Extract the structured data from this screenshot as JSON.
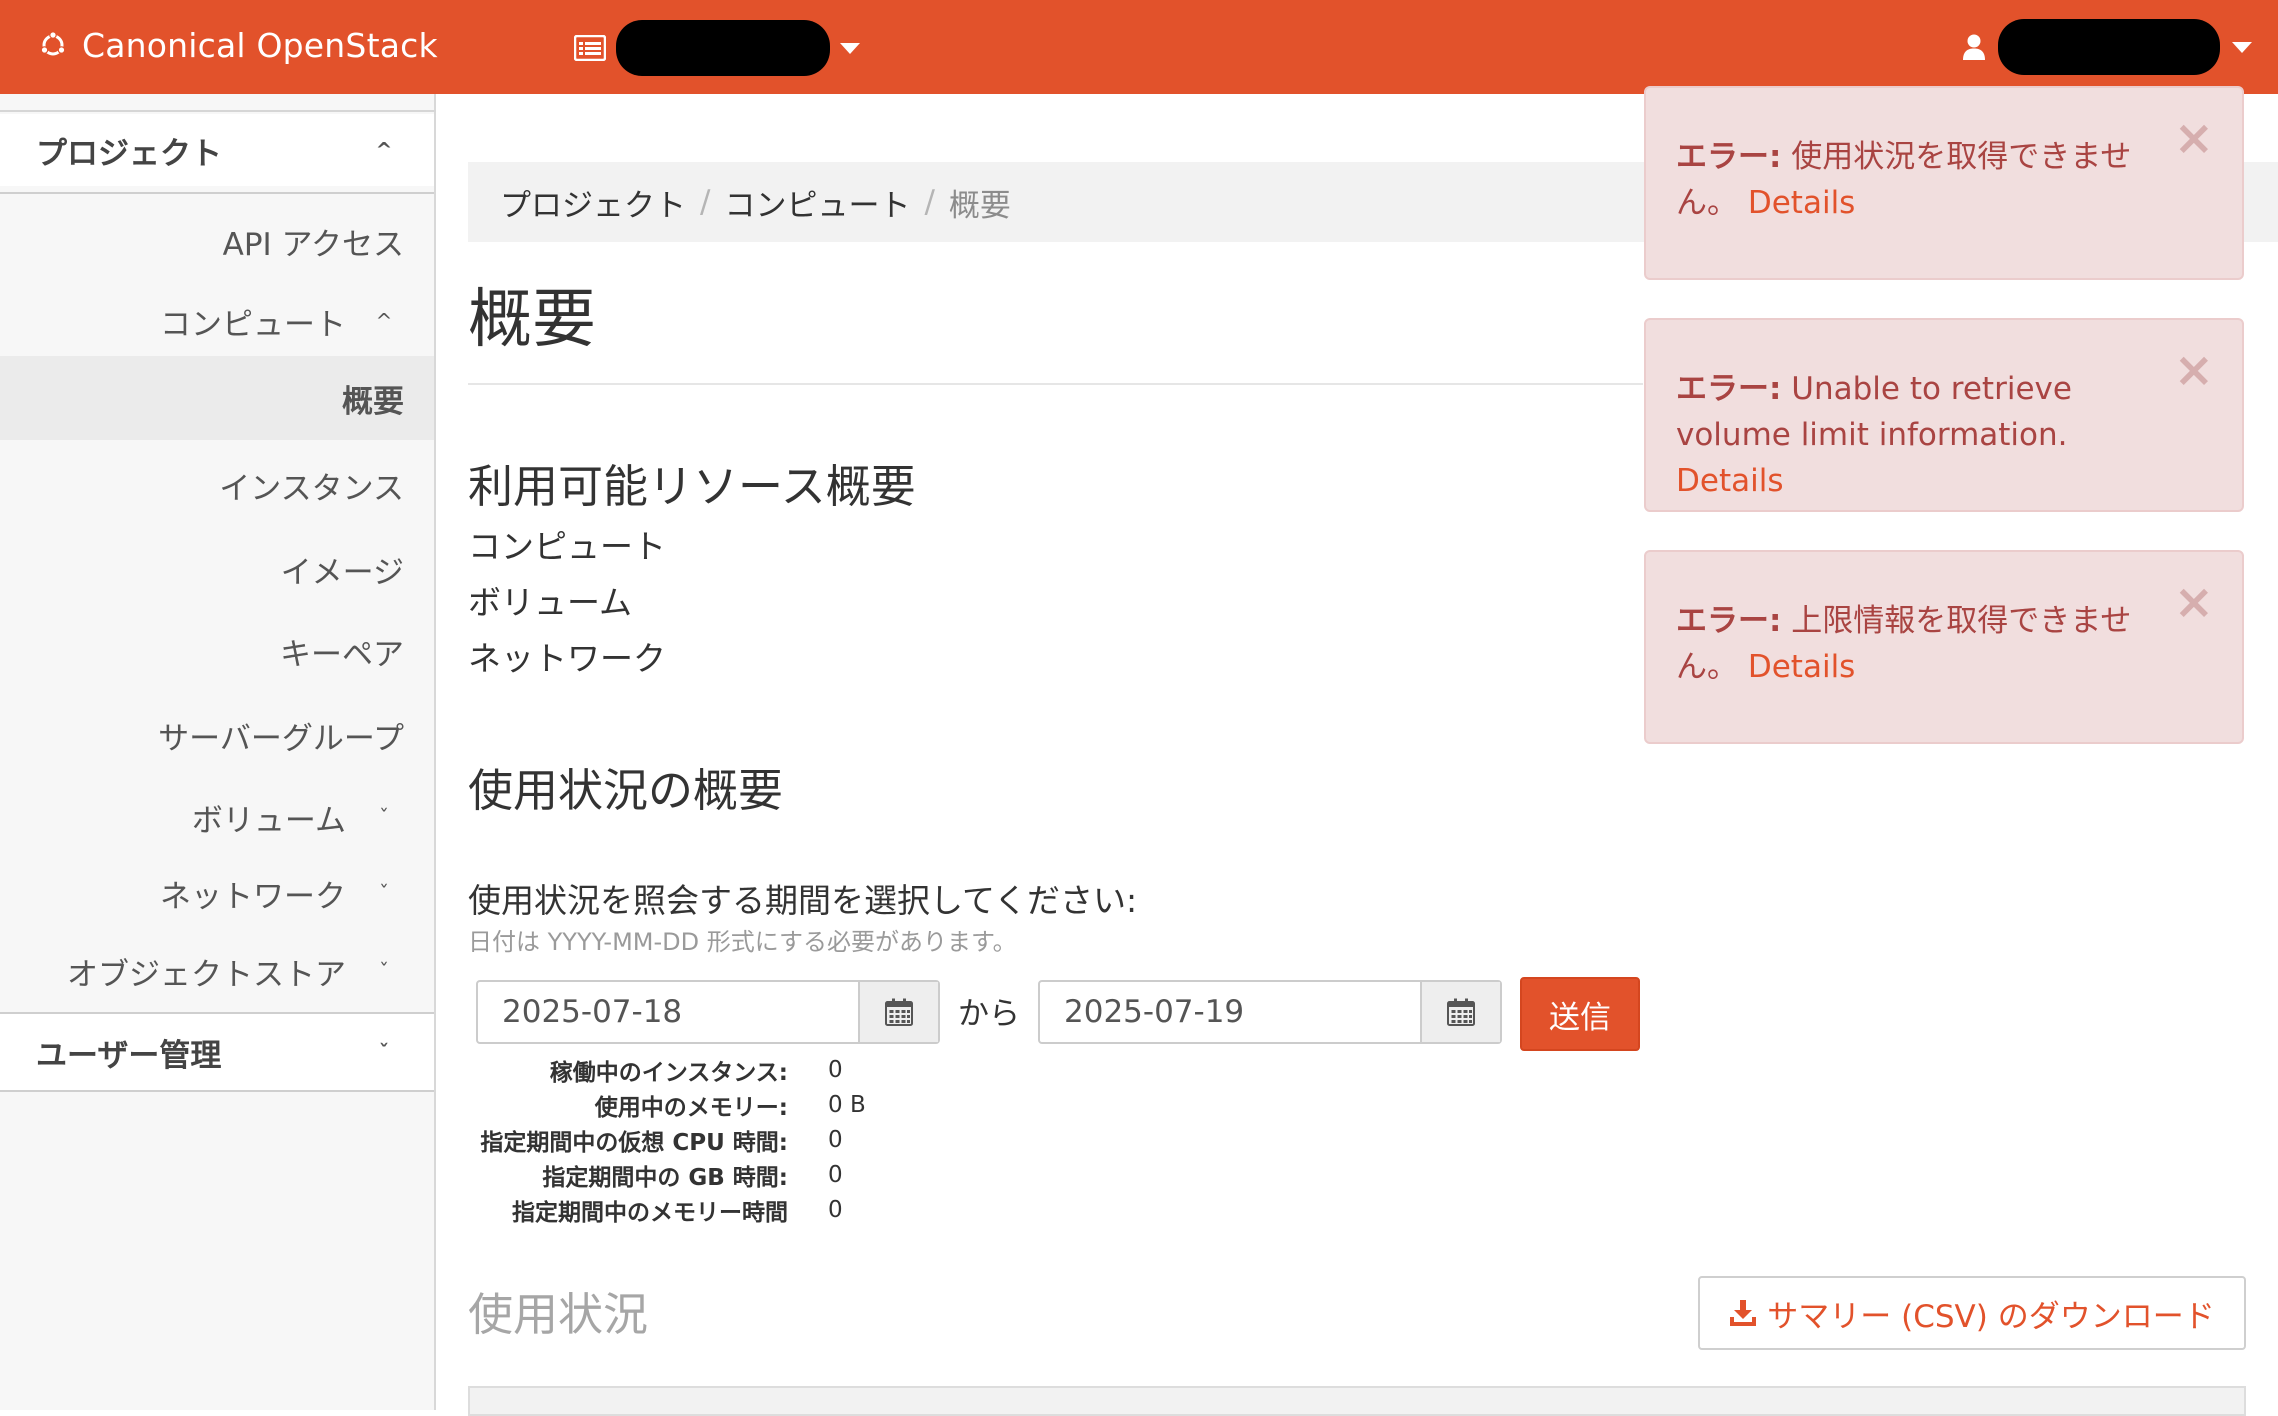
{
  "navbar": {
    "brand": "Canonical OpenStack",
    "icons": {
      "brand": "ubuntu-circle-icon",
      "project": "project-list-icon",
      "user": "user-icon"
    }
  },
  "sidebar": {
    "project_section": "プロジェクト",
    "api_access": "API アクセス",
    "compute": "コンピュート",
    "overview": "概要",
    "instances": "インスタンス",
    "images": "イメージ",
    "keypairs": "キーペア",
    "server_groups": "サーバーグループ",
    "volumes": "ボリューム",
    "network": "ネットワーク",
    "object_store": "オブジェクトストア",
    "identity_section": "ユーザー管理",
    "chevron_up": "^",
    "chevron_down": "ˇ"
  },
  "breadcrumb": {
    "items": [
      "プロジェクト",
      "コンピュート",
      "概要"
    ],
    "separator": "/"
  },
  "page": {
    "title": "概要",
    "limits_heading": "利用可能リソース概要",
    "limits": [
      "コンピュート",
      "ボリューム",
      "ネットワーク"
    ],
    "usage_heading": "使用状況の概要",
    "period_label": "使用状況を照会する期間を選択してください:",
    "period_help": "日付は YYYY-MM-DD 形式にする必要があります。",
    "start_date": "2025-07-18",
    "from_text": "から",
    "end_date": "2025-07-19",
    "submit": "送信",
    "stats": [
      {
        "label": "稼働中のインスタンス:",
        "value": "0"
      },
      {
        "label": "使用中のメモリー:",
        "value": "0 B"
      },
      {
        "label": "指定期間中の仮想 CPU 時間:",
        "value": "0"
      },
      {
        "label": "指定期間中の GB 時間:",
        "value": "0"
      },
      {
        "label": "指定期間中のメモリー時間",
        "value": "0"
      }
    ],
    "usage_table_heading": "使用状況",
    "csv_button": "サマリー (CSV) のダウンロード"
  },
  "alerts": [
    {
      "prefix": "エラー:",
      "message": "使用状況を取得できません。",
      "link": "Details"
    },
    {
      "prefix": "エラー:",
      "message": "Unable to retrieve volume limit information.",
      "link": "Details"
    },
    {
      "prefix": "エラー:",
      "message": "上限情報を取得できません。",
      "link": "Details"
    }
  ],
  "alert_close": "×",
  "colors": {
    "brand": "#e2522b",
    "alert_bg": "#f1dede",
    "alert_text": "#a94442"
  }
}
